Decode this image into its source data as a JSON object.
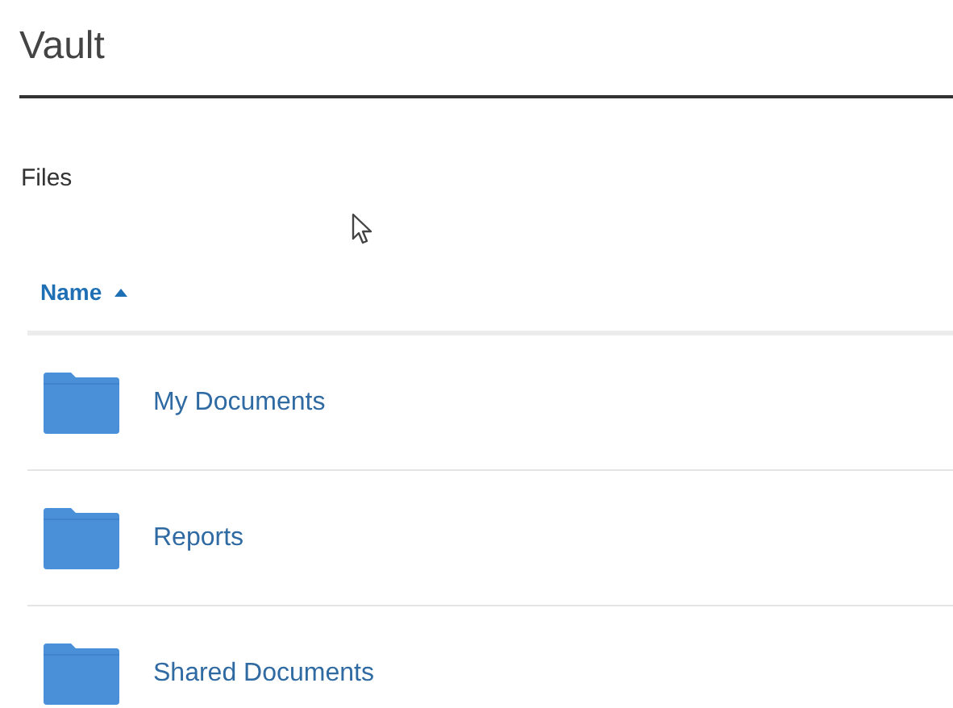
{
  "page": {
    "title": "Vault"
  },
  "section": {
    "title": "Files"
  },
  "table": {
    "columns": [
      {
        "label": "Name",
        "sort_ascending": true
      }
    ],
    "rows": [
      {
        "kind": "folder",
        "name": "My Documents"
      },
      {
        "kind": "folder",
        "name": "Reports"
      },
      {
        "kind": "folder",
        "name": "Shared Documents"
      }
    ]
  }
}
